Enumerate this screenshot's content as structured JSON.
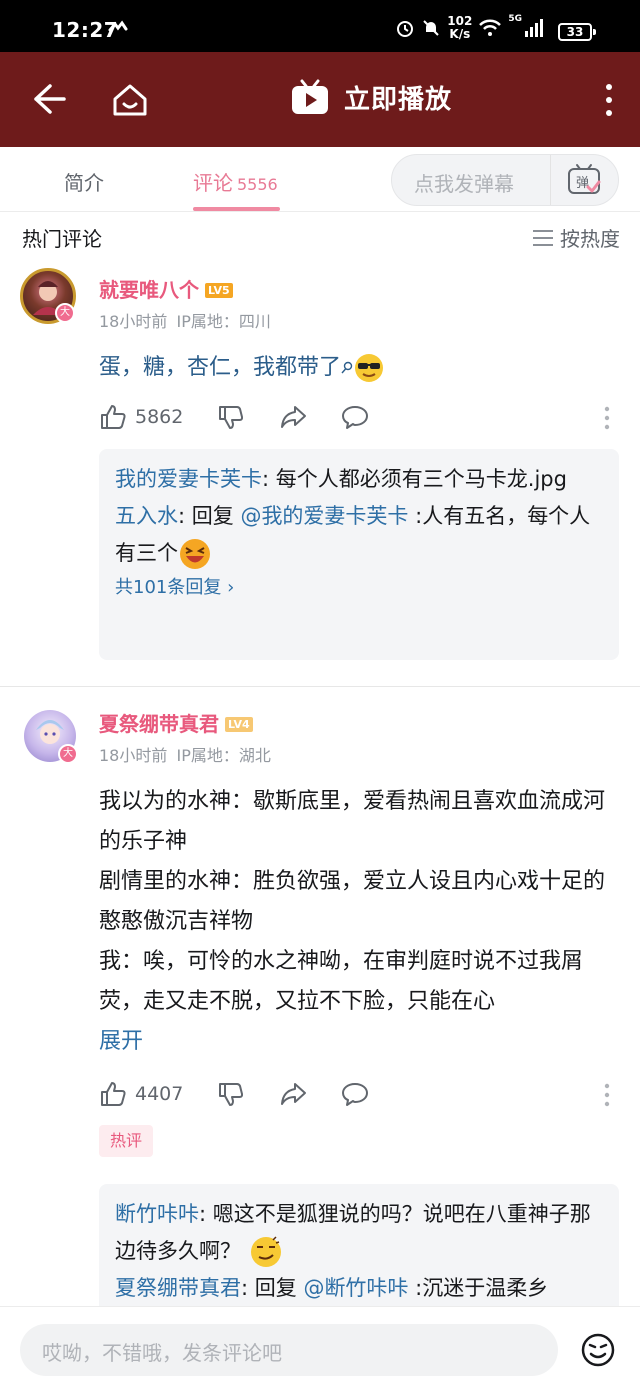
{
  "status_bar": {
    "time": "12:27",
    "speed_value": "102",
    "speed_unit": "K/s",
    "network": "5G",
    "battery": "33"
  },
  "header": {
    "title": "立即播放"
  },
  "tabs": {
    "intro_label": "简介",
    "comments_label": "评论",
    "comments_count": "5556",
    "danmaku_placeholder": "点我发弹幕",
    "danmaku_button": "弹"
  },
  "section": {
    "title": "热门评论",
    "sort_label": "按热度"
  },
  "comments": [
    {
      "username": "就要唯八个",
      "level": "LV5",
      "time": "18小时前",
      "ip": "IP属地：四川",
      "text": "蛋，糖，杏仁，我都带了",
      "likes": "5862",
      "replies": [
        {
          "user": "我的爱妻卡芙卡",
          "sep": ": ",
          "text": "每个人都必须有三个马卡龙.jpg"
        },
        {
          "user": "五入水",
          "sep": ": 回复 ",
          "mention": "@我的爱妻卡芙卡",
          "text": " :人有五名，每个人有三个"
        }
      ],
      "reply_summary": "共101条回复 ›"
    },
    {
      "username": "夏祭绷带真君",
      "level": "LV4",
      "time": "18小时前",
      "ip": "IP属地：湖北",
      "lines": [
        "我以为的水神：歇斯底里，爱看热闹且喜欢血流成河的乐子神",
        "剧情里的水神：胜负欲强，爱立人设且内心戏十足的憨憨傲沉吉祥物",
        "我：唉，可怜的水之神呦，在审判庭时说不过我屑荧，走又走不脱，又拉不下脸，只能在心"
      ],
      "expand": "展开",
      "likes": "4407",
      "tag": "热评",
      "replies": [
        {
          "user": "断竹咔咔",
          "sep": ": ",
          "text": "嗯这不是狐狸说的吗？说吧在八重神子那边待多久啊？"
        },
        {
          "user": "夏祭绷带真君",
          "sep": ": 回复 ",
          "mention": "@断竹咔咔",
          "text": " :沉迷于温柔乡"
        }
      ]
    }
  ],
  "bottom": {
    "placeholder": "哎呦，不错哦，发条评论吧"
  },
  "colors": {
    "header_bg": "#6e1b1b",
    "accent_pink": "#e8597d",
    "link_blue": "#2e6fa6"
  }
}
